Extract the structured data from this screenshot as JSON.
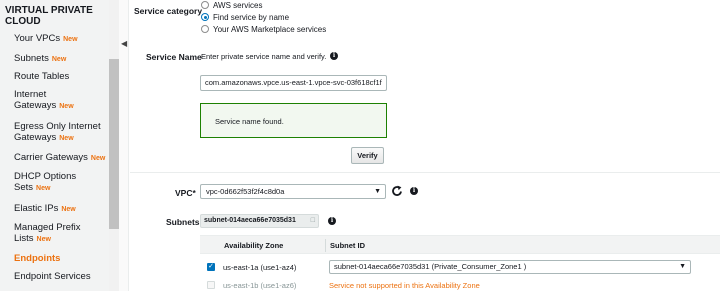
{
  "sidebar": {
    "title": "VIRTUAL PRIVATE CLOUD",
    "new_badge": "New",
    "items": [
      {
        "label": "Your VPCs",
        "new": true
      },
      {
        "label": "Subnets",
        "new": true
      },
      {
        "label": "Route Tables",
        "new": false
      },
      {
        "label": "Internet Gateways",
        "new": true
      },
      {
        "label": "Egress Only Internet Gateways",
        "new": true
      },
      {
        "label": "Carrier Gateways",
        "new": true
      },
      {
        "label": "DHCP Options Sets",
        "new": true
      },
      {
        "label": "Elastic IPs",
        "new": true
      },
      {
        "label": "Managed Prefix Lists",
        "new": true
      },
      {
        "label": "Endpoints",
        "new": false,
        "active": true
      },
      {
        "label": "Endpoint Services",
        "new": false
      }
    ]
  },
  "service_category": {
    "label": "Service category",
    "options": [
      "AWS services",
      "Find service by name",
      "Your AWS Marketplace services"
    ],
    "selected": "Find service by name"
  },
  "service_name": {
    "label": "Service Name",
    "hint": "Enter private service name and verify.",
    "value": "com.amazonaws.vpce.us-east-1.vpce-svc-03f618cf1f",
    "status_message": "Service name found.",
    "verify_label": "Verify"
  },
  "vpc": {
    "label": "VPC*",
    "value": "vpc-0d662f53f2f4c8d0a"
  },
  "subnets": {
    "label": "Subnets",
    "chip": "subnet-014aeca66e7035d31",
    "chip_remove": "□",
    "columns": [
      "Availability Zone",
      "Subnet ID"
    ],
    "rows": [
      {
        "checked": true,
        "zone": "us-east-1a (use1-az4)",
        "subnet": "subnet-014aeca66e7035d31 (Private_Consumer_Zone1 )",
        "disabled": false
      },
      {
        "checked": false,
        "zone": "us-east-1b (use1-az6)",
        "subnet": "Service not supported in this Availability Zone",
        "disabled": true
      }
    ]
  },
  "colors": {
    "accent": "#ec7211",
    "link": "#0073bb",
    "success_border": "#1d8102",
    "success_bg": "#f2f8f0"
  }
}
